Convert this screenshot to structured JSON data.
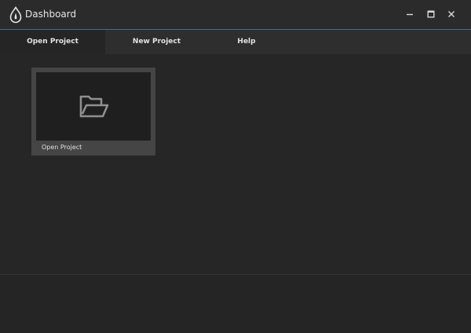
{
  "window": {
    "title": "Dashboard",
    "controls": {
      "minimize": "minimize-icon",
      "maximize": "maximize-icon",
      "close": "close-icon"
    }
  },
  "tabs": [
    {
      "label": "Open Project",
      "active": true
    },
    {
      "label": "New Project",
      "active": false
    },
    {
      "label": "Help",
      "active": false
    }
  ],
  "main": {
    "cards": [
      {
        "label": "Open Project",
        "icon": "folder-open-icon"
      }
    ]
  },
  "colors": {
    "accent_line": "#3f6e8c",
    "background": "#262626",
    "card": "#454545",
    "text": "#e2e2e2"
  }
}
